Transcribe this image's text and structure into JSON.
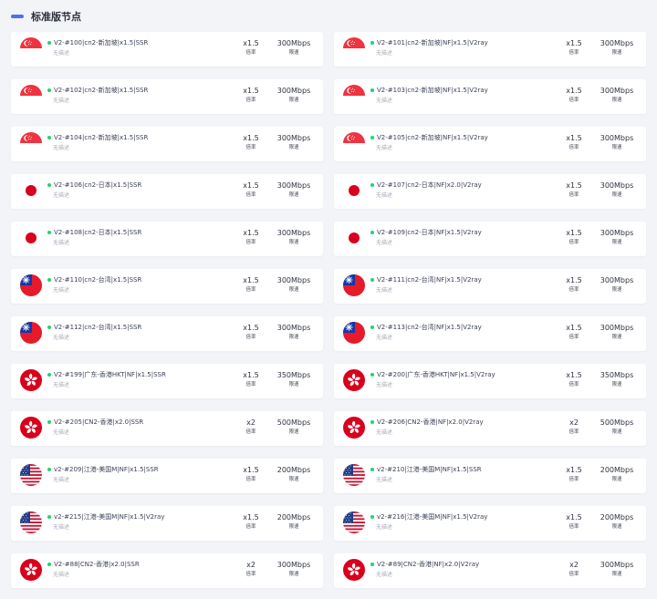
{
  "section": {
    "title": "标准版节点"
  },
  "labels": {
    "rate": "倍率",
    "speed": "限速"
  },
  "colors": {
    "accent": "#4e6ef2",
    "online": "#22d36b"
  },
  "nodes": [
    {
      "name": "V2-#100|cn2-新加坡|x1.5|SSR",
      "desc": "无描述",
      "rate": "x1.5",
      "speed": "300Mbps",
      "flag": "sg-flag-icon"
    },
    {
      "name": "V2-#101|cn2-新加坡|NF|x1.5|V2ray",
      "desc": "无描述",
      "rate": "x1.5",
      "speed": "300Mbps",
      "flag": "sg-flag-icon"
    },
    {
      "name": "V2-#102|cn2-新加坡|x1.5|SSR",
      "desc": "无描述",
      "rate": "x1.5",
      "speed": "300Mbps",
      "flag": "sg-flag-icon"
    },
    {
      "name": "V2-#103|cn2-新加坡|NF|x1.5|V2ray",
      "desc": "无描述",
      "rate": "x1.5",
      "speed": "300Mbps",
      "flag": "sg-flag-icon"
    },
    {
      "name": "V2-#104|cn2-新加坡|x1.5|SSR",
      "desc": "无描述",
      "rate": "x1.5",
      "speed": "300Mbps",
      "flag": "sg-flag-icon"
    },
    {
      "name": "V2-#105|cn2-新加坡|NF|x1.5|V2ray",
      "desc": "无描述",
      "rate": "x1.5",
      "speed": "300Mbps",
      "flag": "sg-flag-icon"
    },
    {
      "name": "V2-#106|cn2-日本|x1.5|SSR",
      "desc": "无描述",
      "rate": "x1.5",
      "speed": "300Mbps",
      "flag": "jp-flag-icon"
    },
    {
      "name": "V2-#107|cn2-日本|NF|x2.0|V2ray",
      "desc": "无描述",
      "rate": "x1.5",
      "speed": "300Mbps",
      "flag": "jp-flag-icon"
    },
    {
      "name": "V2-#108|cn2-日本|x1.5|SSR",
      "desc": "无描述",
      "rate": "x1.5",
      "speed": "300Mbps",
      "flag": "jp-flag-icon"
    },
    {
      "name": "V2-#109|cn2-日本|NF|x1.5|V2ray",
      "desc": "无描述",
      "rate": "x1.5",
      "speed": "300Mbps",
      "flag": "jp-flag-icon"
    },
    {
      "name": "V2-#110|cn2-台湾|x1.5|SSR",
      "desc": "无描述",
      "rate": "x1.5",
      "speed": "300Mbps",
      "flag": "tw-flag-icon"
    },
    {
      "name": "V2-#111|cn2-台湾|NF|x1.5|V2ray",
      "desc": "无描述",
      "rate": "x1.5",
      "speed": "300Mbps",
      "flag": "tw-flag-icon"
    },
    {
      "name": "V2-#112|cn2-台湾|x1.5|SSR",
      "desc": "无描述",
      "rate": "x1.5",
      "speed": "300Mbps",
      "flag": "tw-flag-icon"
    },
    {
      "name": "V2-#113|cn2-台湾|NF|x1.5|V2ray",
      "desc": "无描述",
      "rate": "x1.5",
      "speed": "300Mbps",
      "flag": "tw-flag-icon"
    },
    {
      "name": "V2-#199|广东-香港HKT|NF|x1.5|SSR",
      "desc": "无描述",
      "rate": "x1.5",
      "speed": "350Mbps",
      "flag": "hk-flag-icon"
    },
    {
      "name": "V2-#200|广东-香港HKT|NF|x1.5|V2ray",
      "desc": "无描述",
      "rate": "x1.5",
      "speed": "350Mbps",
      "flag": "hk-flag-icon"
    },
    {
      "name": "V2-#205|CN2-香港|x2.0|SSR",
      "desc": "无描述",
      "rate": "x2",
      "speed": "500Mbps",
      "flag": "hk-flag-icon"
    },
    {
      "name": "V2-#206|CN2-香港|NF|x2.0|V2ray",
      "desc": "无描述",
      "rate": "x2",
      "speed": "500Mbps",
      "flag": "hk-flag-icon"
    },
    {
      "name": "v2-#209|江港-美国M|NF|x1.5|SSR",
      "desc": "无描述",
      "rate": "x1.5",
      "speed": "200Mbps",
      "flag": "us-flag-icon"
    },
    {
      "name": "v2-#210|江港-美国M|NF|x1.5|SSR",
      "desc": "无描述",
      "rate": "x1.5",
      "speed": "200Mbps",
      "flag": "us-flag-icon"
    },
    {
      "name": "v2-#215|江港-美国M|NF|x1.5|V2ray",
      "desc": "无描述",
      "rate": "x1.5",
      "speed": "200Mbps",
      "flag": "us-flag-icon"
    },
    {
      "name": "v2-#216|江港-美国M|NF|x1.5|V2ray",
      "desc": "无描述",
      "rate": "x1.5",
      "speed": "200Mbps",
      "flag": "us-flag-icon"
    },
    {
      "name": "V2-#88|CN2-香港|x2.0|SSR",
      "desc": "无描述",
      "rate": "x2",
      "speed": "300Mbps",
      "flag": "hk-flag-icon"
    },
    {
      "name": "V2-#89|CN2-香港|NF|x2.0|V2ray",
      "desc": "无描述",
      "rate": "x2",
      "speed": "300Mbps",
      "flag": "hk-flag-icon"
    }
  ]
}
